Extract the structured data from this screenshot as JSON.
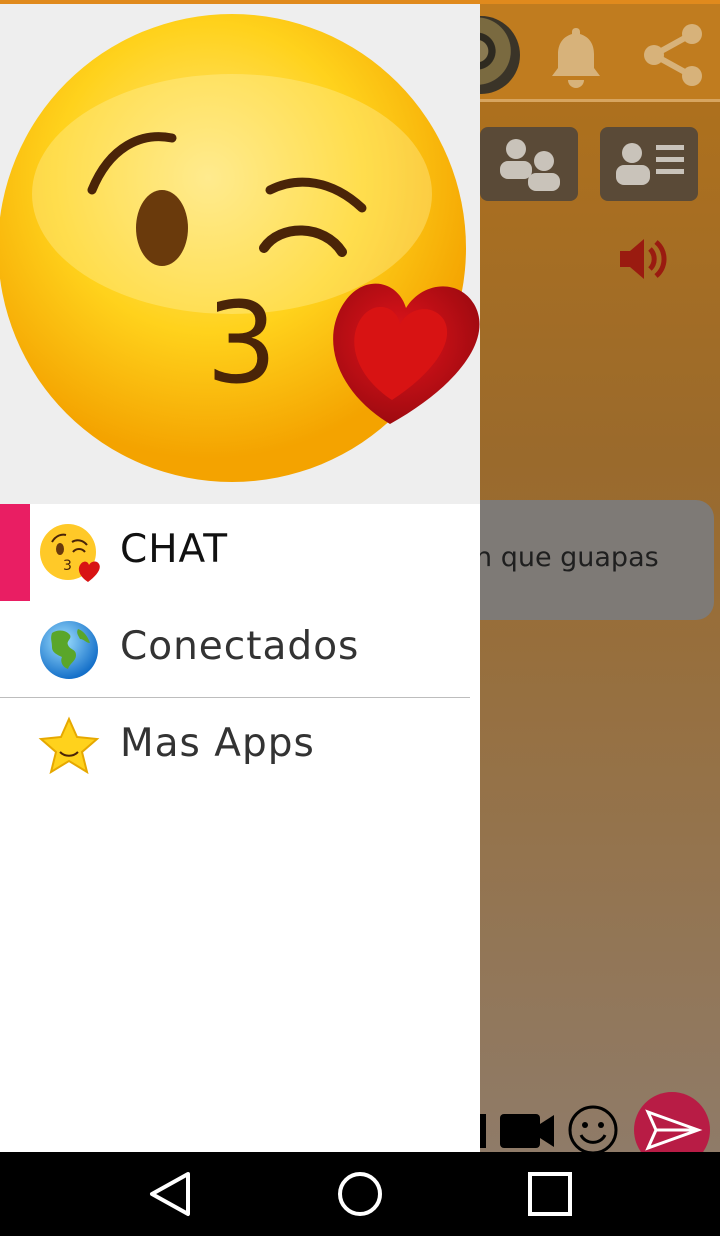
{
  "message": {
    "text": "n que guapas"
  },
  "drawer": {
    "items": [
      {
        "label": "CHAT",
        "icon": "kiss-emoji-icon",
        "active": true
      },
      {
        "label": "Conectados",
        "icon": "globe-icon",
        "active": false
      },
      {
        "label": "Mas Apps",
        "icon": "star-icon",
        "active": false
      }
    ]
  },
  "colors": {
    "accent": "#e91e63",
    "appbar": "#c07c1f",
    "send_button": "#b81c45"
  },
  "icons": {
    "appbar": [
      "avatar",
      "bell-icon",
      "share-icon"
    ],
    "toolbar": [
      "group-users-icon",
      "user-list-icon"
    ],
    "bottom": [
      "video-camera-icon",
      "smiley-icon",
      "send-icon"
    ],
    "navbar": [
      "back-icon",
      "home-icon",
      "recents-icon"
    ]
  }
}
